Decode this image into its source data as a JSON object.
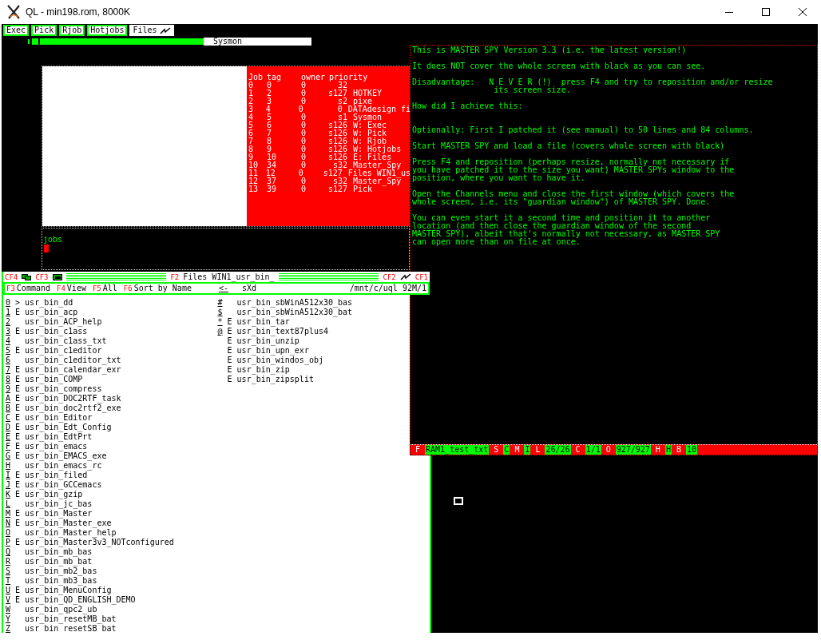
{
  "window": {
    "title": "QL - min198.rom, 8000K"
  },
  "hotkey_buttons": [
    {
      "label": "Exec",
      "selected": false
    },
    {
      "label": "Pick",
      "selected": false
    },
    {
      "label": "Rjob",
      "selected": false
    },
    {
      "label": "Hotjobs",
      "selected": false
    },
    {
      "label": "Files",
      "selected": true
    }
  ],
  "sysmon": {
    "label": "Sysmon"
  },
  "jobs_table": {
    "columns": [
      "Job",
      "tag",
      "owner",
      "priority"
    ],
    "rows": [
      [
        "0",
        "0",
        "0",
        "32",
        null
      ],
      [
        "1",
        "2",
        "0",
        "s127",
        "HOTKEY"
      ],
      [
        "2",
        "3",
        "0",
        "s2",
        "pixe"
      ],
      [
        "3",
        "4",
        "0",
        "0",
        "DATAdesign fi"
      ],
      [
        "4",
        "5",
        "0",
        "s1",
        "Sysmon"
      ],
      [
        "5",
        "6",
        "0",
        "s126",
        "W: Exec"
      ],
      [
        "6",
        "7",
        "0",
        "s126",
        "W: Pick"
      ],
      [
        "7",
        "8",
        "0",
        "s126",
        "W: Rjob"
      ],
      [
        "8",
        "9",
        "0",
        "s126",
        "W: Hotjobs"
      ],
      [
        "9",
        "10",
        "0",
        "s126",
        "E: Files"
      ],
      [
        "10",
        "34",
        "0",
        "s32",
        "Master_Spy"
      ],
      [
        "11",
        "12",
        "0",
        "s127",
        "Files WIN1_us"
      ],
      [
        "12",
        "37",
        "0",
        "s32",
        "Master_Spy"
      ],
      [
        "13",
        "39",
        "0",
        "s127",
        "Pick"
      ]
    ]
  },
  "console": {
    "text": "jobs"
  },
  "files_window": {
    "header": {
      "left_keys": [
        "CF4",
        "CF3"
      ],
      "title_key": "F2",
      "title": "Files WIN1_usr_bin_",
      "right_keys": [
        "CF2",
        "CF1"
      ]
    },
    "menu": [
      {
        "key": "F3",
        "label": "Command"
      },
      {
        "key": "F4",
        "label": "View"
      },
      {
        "key": "F5",
        "label": "All"
      },
      {
        "key": "F6",
        "label": "Sort by Name"
      }
    ],
    "back": "<-",
    "mode": "sXd",
    "path": "/mnt/c/uql 92M/1",
    "columns": [
      [
        {
          "key": "0",
          "flag": ">",
          "name": "usr_bin_dd"
        },
        {
          "key": "1",
          "flag": "E",
          "name": "usr_bin_acp"
        },
        {
          "key": "2",
          "name": "usr_bin_ACP_help"
        },
        {
          "key": "3",
          "flag": "E",
          "name": "usr_bin_c1ass"
        },
        {
          "key": "4",
          "name": "usr_bin_c1ass_txt"
        },
        {
          "key": "5",
          "flag": "E",
          "name": "usr_bin_c1editor"
        },
        {
          "key": "6",
          "name": "usr_bin_c1editor_txt"
        },
        {
          "key": "7",
          "flag": "E",
          "name": "usr_bin_calendar_exr"
        },
        {
          "key": "8",
          "flag": "E",
          "name": "usr_bin_COMP"
        },
        {
          "key": "9",
          "flag": "E",
          "name": "usr_bin_compress"
        },
        {
          "key": "A",
          "flag": "E",
          "name": "usr_bin_DOC2RTF_task"
        },
        {
          "key": "B",
          "flag": "E",
          "name": "usr_bin_doc2rtf2_exe"
        },
        {
          "key": "C",
          "flag": "E",
          "name": "usr_bin_Editor"
        },
        {
          "key": "D",
          "flag": "E",
          "name": "usr_bin_Edt_Config"
        },
        {
          "key": "E",
          "flag": "E",
          "name": "usr_bin_EdtPrt"
        },
        {
          "key": "F",
          "flag": "E",
          "name": "usr_bin_emacs"
        },
        {
          "key": "G",
          "flag": "E",
          "name": "usr_bin_EMACS_exe"
        },
        {
          "key": "H",
          "name": "usr_bin_emacs_rc"
        },
        {
          "key": "I",
          "flag": "E",
          "name": "usr_bin_filed"
        },
        {
          "key": "J",
          "flag": "E",
          "name": "usr_bin_GCCemacs"
        },
        {
          "key": "K",
          "flag": "E",
          "name": "usr_bin_gzip"
        },
        {
          "key": "L",
          "name": "usr_bin_jc_bas"
        },
        {
          "key": "M",
          "flag": "E",
          "name": "usr_bin_Master"
        },
        {
          "key": "N",
          "flag": "E",
          "name": "usr_bin_Master_exe"
        },
        {
          "key": "O",
          "name": "usr_bin_Master_help"
        },
        {
          "key": "P",
          "flag": "E",
          "name": "usr_bin_Master3v3_NOTconfigured"
        },
        {
          "key": "Q",
          "name": "usr_bin_mb_bas"
        },
        {
          "key": "R",
          "name": "usr_bin_mb_bat"
        },
        {
          "key": "S",
          "name": "usr_bin_mb2_bas"
        },
        {
          "key": "T",
          "name": "usr_bin_mb3_bas"
        },
        {
          "key": "U",
          "flag": "E",
          "name": "usr_bin_MenuConfig"
        },
        {
          "key": "V",
          "flag": "E",
          "name": "usr_bin_QD_ENGLISH_DEMO"
        },
        {
          "key": "W",
          "name": "usr_bin_qpc2_ub"
        },
        {
          "key": "Y",
          "name": "usr_bin_resetMB_bat"
        },
        {
          "key": "Z",
          "name": "usr_bin_resetSB_bat"
        }
      ],
      [
        {
          "key": "#",
          "name": "usr_bin_sbWinA512x30_bas"
        },
        {
          "key": "$",
          "name": "usr_bin_sbWinA512x30_bat"
        },
        {
          "key": "*",
          "flag": "E",
          "name": "usr_bin_tar"
        },
        {
          "key": "@",
          "flag": "E",
          "name": "usr_bin_text87plus4"
        },
        {
          "flag": "E",
          "name": "usr_bin_unzip"
        },
        {
          "flag": "E",
          "name": "usr_bin_upn_exr"
        },
        {
          "flag": "E",
          "name": "usr_bin_windos_obj"
        },
        {
          "flag": "E",
          "name": "usr_bin_zip"
        },
        {
          "flag": "E",
          "name": "usr_bin_zipsplit"
        }
      ]
    ]
  },
  "master_spy": {
    "paragraphs": [
      [
        "This is MASTER SPY Version 3.3 (i.e. the latest version!)"
      ],
      [
        "It does NOT cover the whole screen with black as you can see."
      ],
      [
        "Disadvantage:   N E V E R (!)  press F4 and try to reposition and/or resize",
        "                 its screen size."
      ],
      [
        "How did I achieve this:"
      ],
      [
        "Optionally: First I patched it (see manual) to 50 lines and 84 columns."
      ],
      [
        "Start MASTER SPY and load a file (covers whole screen with black)"
      ],
      [
        "Press F4 and reposition (perhaps resize, normally not necessary if",
        "you have patched it to the size you want) MASTER SPYs window to the",
        "position, where you want to have it."
      ],
      [
        "Open the Channels menu and close the first window (which covers the",
        "whole screen, i.e. its \"guardian window\") of MASTER SPY. Done."
      ],
      [
        "You can even start it a second time and position it to another",
        "location (and then close the guardian window of the second",
        "MASTER SPY), albeit that's normally not necessary, as MASTER SPY",
        "can open more than on file at once."
      ]
    ],
    "status": [
      {
        "text": "F",
        "color": "#ff0000"
      },
      {
        "text": "RAM1_test_txt",
        "color": "#00ff00"
      },
      {
        "text": "S",
        "color": "#ff0000"
      },
      {
        "text": "C",
        "color": "#00ff00"
      },
      {
        "text": "M",
        "color": "#ff0000"
      },
      {
        "text": "I",
        "color": "#00ff00"
      },
      {
        "text": "L",
        "color": "#ff0000"
      },
      {
        "text": "26/26",
        "color": "#00ff00"
      },
      {
        "text": "C",
        "color": "#ff0000"
      },
      {
        "text": "1/1",
        "color": "#00ff00"
      },
      {
        "text": "O",
        "color": "#ff0000"
      },
      {
        "text": "927/927",
        "color": "#00ff00"
      },
      {
        "text": "H",
        "color": "#ff0000"
      },
      {
        "text": "H",
        "color": "#00ff00"
      },
      {
        "text": "B",
        "color": "#ff0000"
      },
      {
        "text": "10",
        "color": "#00ff00"
      }
    ]
  }
}
